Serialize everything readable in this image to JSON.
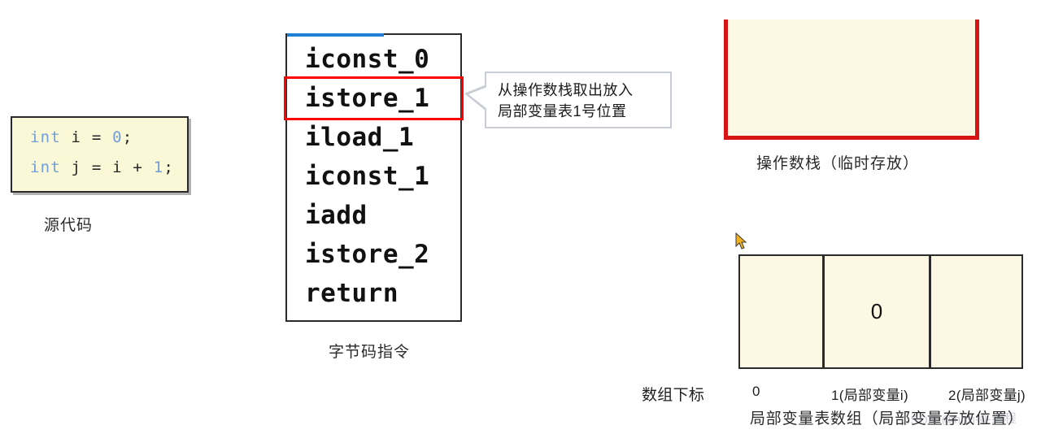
{
  "source_code": {
    "caption": "源代码",
    "lines": [
      {
        "prefix": "",
        "keyword": "int",
        "middle": " i = ",
        "value": "0",
        "suffix": ";"
      },
      {
        "prefix": "",
        "keyword": "int",
        "middle": " j = i + ",
        "value": "1",
        "suffix": ";"
      }
    ],
    "line1_keyword": "int",
    "line1_middle": " i = ",
    "line1_value": "0",
    "line1_suffix": ";",
    "line2_keyword": "int",
    "line2_middle": " j = i + ",
    "line2_value": "1",
    "line2_suffix": ";"
  },
  "bytecode": {
    "caption": "字节码指令",
    "instructions": [
      {
        "text": "iconst_0",
        "highlighted": false
      },
      {
        "text": "istore_1",
        "highlighted": true
      },
      {
        "text": "iload_1",
        "highlighted": false
      },
      {
        "text": "iconst_1",
        "highlighted": false
      },
      {
        "text": "iadd",
        "highlighted": false
      },
      {
        "text": "istore_2",
        "highlighted": false
      },
      {
        "text": "return",
        "highlighted": false
      }
    ],
    "highlight_color": "#ff0000",
    "accent_color": "#1f7fd4"
  },
  "callout": {
    "line1": "从操作数栈取出放入",
    "line2": "局部变量表1号位置",
    "border_color": "#c9cdd6"
  },
  "operand_stack": {
    "caption": "操作数栈（临时存放）",
    "border_color": "#d61414",
    "fill_color": "#fdf8e3",
    "contents": [
      "",
      "",
      ""
    ]
  },
  "local_variable_table": {
    "cells": [
      "",
      "0",
      ""
    ],
    "index_title": "数组下标",
    "index_labels": [
      "0",
      "1(局部变量i)",
      "2(局部变量j)"
    ],
    "caption": "局部变量表数组（局部变量存放位置）",
    "fill_color": "#fdf8e3"
  },
  "watermark": {
    "text": "CSDN @hhh-0-编程"
  }
}
